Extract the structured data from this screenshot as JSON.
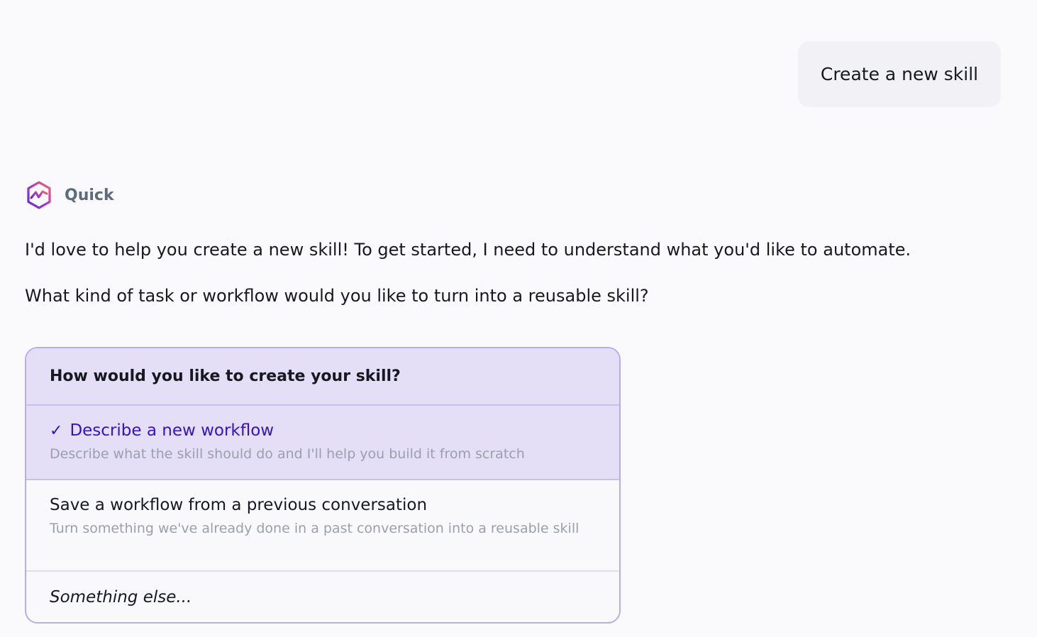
{
  "user_message": "Create a new skill",
  "assistant": {
    "name": "Quick",
    "logo_icon": "quick-hexagon-logo-icon",
    "messages": [
      "I'd love to help you create a new skill! To get started, I need to understand what you'd like to automate.",
      "What kind of task or workflow would you like to turn into a reusable skill?"
    ]
  },
  "choice_card": {
    "question": "How would you like to create your skill?",
    "options": [
      {
        "check": "✓",
        "title": "Describe a new workflow",
        "description": "Describe what the skill should do and I'll help you build it from scratch",
        "selected": true
      },
      {
        "title": "Save a workflow from a previous conversation",
        "description": "Turn something we've already done in a past conversation into a reusable skill",
        "selected": false
      },
      {
        "title": "Something else...",
        "selected": false
      }
    ]
  },
  "colors": {
    "accent": "#3a0fc7",
    "selected_background": "#e4dff7",
    "card_border": "#b8aee6",
    "page_background": "#fafafc"
  }
}
